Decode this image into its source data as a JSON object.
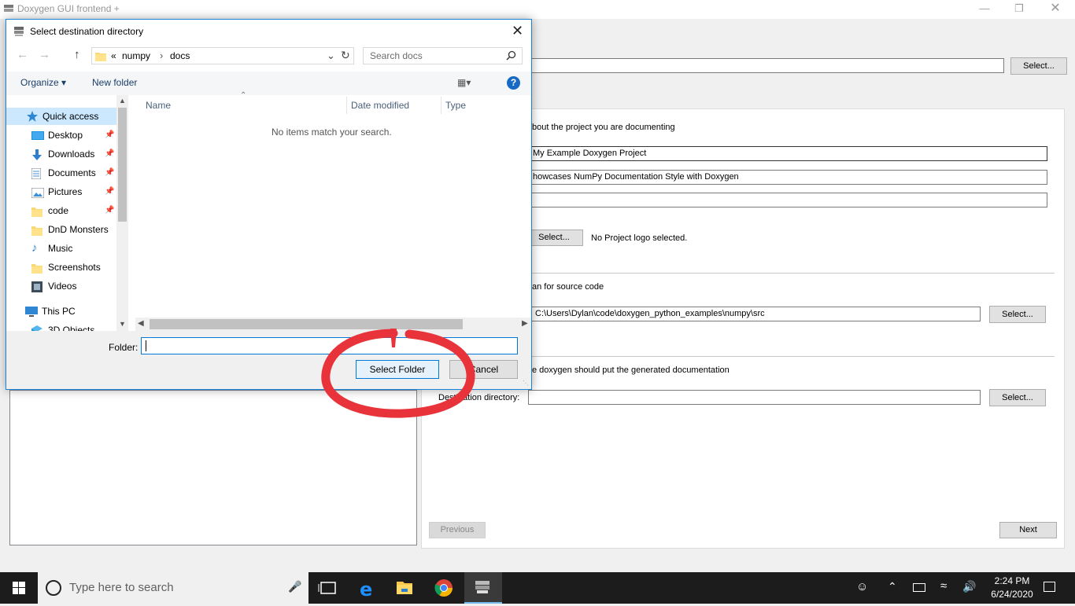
{
  "main_window": {
    "title": "Doxygen GUI frontend +",
    "working_dir_button": "Select...",
    "project_section_label": "bout the project you are documenting",
    "project_name_value": "My Example Doxygen Project",
    "project_brief_value": "howcases NumPy Documentation Style with Doxygen",
    "project_number_value": "",
    "logo_button": "Select...",
    "logo_status": "No Project logo selected.",
    "source_section_label": "an for source code",
    "source_dir_value": "C:\\Users\\Dylan\\code\\doxygen_python_examples\\numpy\\src",
    "source_dir_button": "Select...",
    "dest_section_label": "e doxygen should put the generated documentation",
    "dest_dir_label": "Destination directory:",
    "dest_dir_value": "",
    "dest_dir_button": "Select...",
    "previous_button": "Previous",
    "next_button": "Next"
  },
  "dialog": {
    "title": "Select destination directory",
    "breadcrumb": [
      "«",
      "numpy",
      "›",
      "docs"
    ],
    "search_placeholder": "Search docs",
    "organize_label": "Organize ▾",
    "new_folder_label": "New folder",
    "nav_items": [
      {
        "label": "Quick access",
        "icon": "star-icon"
      },
      {
        "label": "Desktop",
        "icon": "desktop-icon",
        "pinned": true
      },
      {
        "label": "Downloads",
        "icon": "download-icon",
        "pinned": true
      },
      {
        "label": "Documents",
        "icon": "document-icon",
        "pinned": true
      },
      {
        "label": "Pictures",
        "icon": "picture-icon",
        "pinned": true
      },
      {
        "label": "code",
        "icon": "folder-icon",
        "pinned": true
      },
      {
        "label": "DnD Monsters",
        "icon": "folder-icon"
      },
      {
        "label": "Music",
        "icon": "music-icon"
      },
      {
        "label": "Screenshots",
        "icon": "folder-icon"
      },
      {
        "label": "Videos",
        "icon": "video-icon"
      },
      {
        "label": "This PC",
        "icon": "computer-icon"
      },
      {
        "label": "3D Objects",
        "icon": "cube-icon"
      }
    ],
    "columns": [
      "Name",
      "Date modified",
      "Type"
    ],
    "empty_message": "No items match your search.",
    "folder_label": "Folder:",
    "folder_value": "",
    "select_folder_button": "Select Folder",
    "cancel_button": "Cancel"
  },
  "taskbar": {
    "search_placeholder": "Type here to search",
    "time": "2:24 PM",
    "date": "6/24/2020"
  },
  "colors": {
    "accent": "#0078d7",
    "annotation": "#e8333b"
  }
}
